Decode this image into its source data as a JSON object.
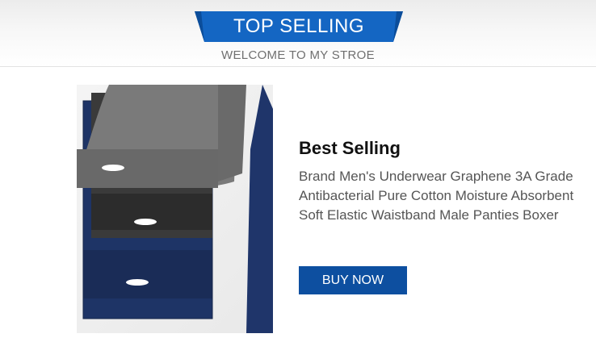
{
  "header": {
    "banner_title": "TOP SELLING",
    "subtitle": "WELCOME TO MY STROE"
  },
  "product": {
    "image_icon": "folded-boxer-briefs-image",
    "title": "Best Selling",
    "description": "Brand Men's Underwear Graphene 3A Grade Antibacterial Pure Cotton Moisture Absorbent Soft Elastic Waistband Male Panties Boxer",
    "buy_label": "BUY NOW"
  },
  "colors": {
    "banner_blue": "#1466c3",
    "button_blue": "#0d4fa0",
    "fabric_gray": "#777777",
    "fabric_black": "#3a3a3a",
    "fabric_navy": "#1e3466"
  }
}
